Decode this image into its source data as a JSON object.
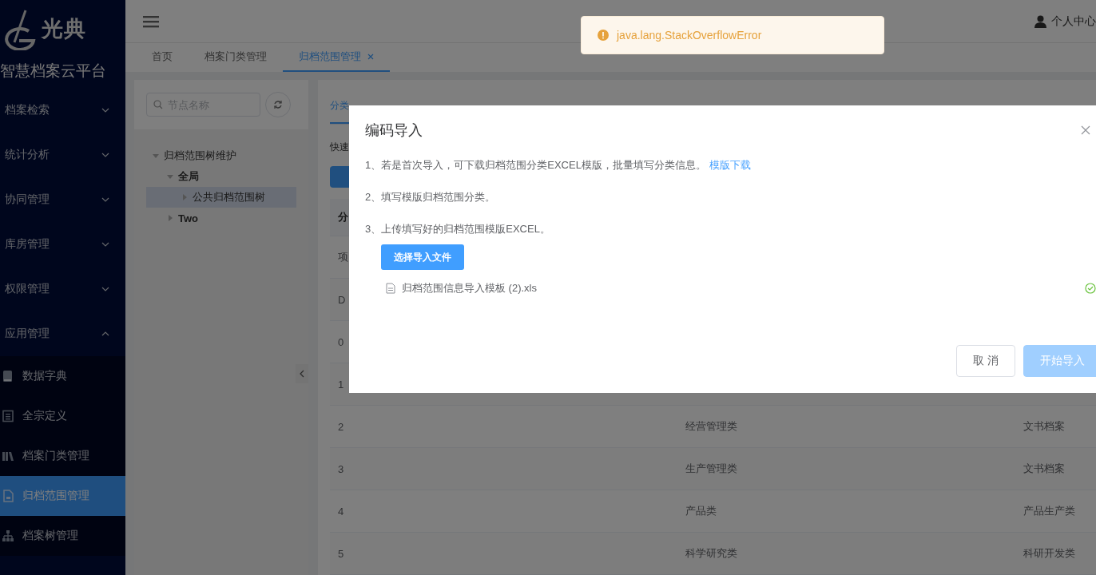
{
  "sidebar": {
    "logo_text": "光典",
    "platform_name": "智慧档案云平台",
    "menu": [
      {
        "label": "档案检索",
        "expanded": false
      },
      {
        "label": "统计分析",
        "expanded": false
      },
      {
        "label": "协同管理",
        "expanded": false
      },
      {
        "label": "库房管理",
        "expanded": false
      },
      {
        "label": "权限管理",
        "expanded": false
      },
      {
        "label": "应用管理",
        "expanded": true,
        "children": [
          {
            "label": "数据字典",
            "selected": false
          },
          {
            "label": "全宗定义",
            "selected": false
          },
          {
            "label": "档案门类管理",
            "selected": false
          },
          {
            "label": "归档范围管理",
            "selected": true
          },
          {
            "label": "档案树管理",
            "selected": false
          }
        ]
      }
    ]
  },
  "header": {
    "user_label": "个人中心"
  },
  "tabs": [
    {
      "label": "首页",
      "selected": false,
      "closable": false
    },
    {
      "label": "档案门类管理",
      "selected": false,
      "closable": false
    },
    {
      "label": "归档范围管理",
      "selected": true,
      "closable": true
    }
  ],
  "toast": {
    "message": "java.lang.StackOverflowError"
  },
  "tree_panel": {
    "search": {
      "placeholder": "节点名称"
    },
    "tree": [
      {
        "label": "归档范围树维护",
        "expanded": true,
        "selected": false,
        "children": [
          {
            "label": "全局",
            "expanded": true,
            "selected": false,
            "children": [
              {
                "label": "公共归档范围树",
                "expanded": false,
                "selected": true
              }
            ]
          },
          {
            "label": "Two",
            "expanded": false,
            "selected": false
          }
        ]
      }
    ]
  },
  "content": {
    "tab": "分类",
    "quick_label": "快速",
    "table": {
      "header": [
        "分"
      ],
      "rows": [
        [
          "项"
        ],
        [
          "D"
        ],
        [
          "0"
        ],
        [
          "1"
        ],
        [
          "2",
          "经营管理类",
          "文书档案"
        ],
        [
          "3",
          "生产管理类",
          "文书档案"
        ],
        [
          "4",
          "产品类",
          "产品生产类"
        ],
        [
          "5",
          "科学研究类",
          "科研开发类"
        ]
      ]
    }
  },
  "dialog": {
    "title": "编码导入",
    "steps": [
      {
        "text": "1、若是首次导入，可下载归档范围分类EXCEL模版，批量填写分类信息。",
        "link": "模版下载"
      },
      {
        "text": "2、填写模版归档范围分类。"
      },
      {
        "text": "3、上传填写好的归档范围模版EXCEL。"
      }
    ],
    "upload_button": "选择导入文件",
    "files": [
      {
        "name": "归档范围信息导入模板 (2).xls",
        "uploaded": true
      }
    ],
    "buttons": [
      {
        "label": "取 消",
        "kind": "default",
        "disabled": false
      },
      {
        "label": "开始导入",
        "kind": "primary",
        "disabled": true
      }
    ]
  }
}
